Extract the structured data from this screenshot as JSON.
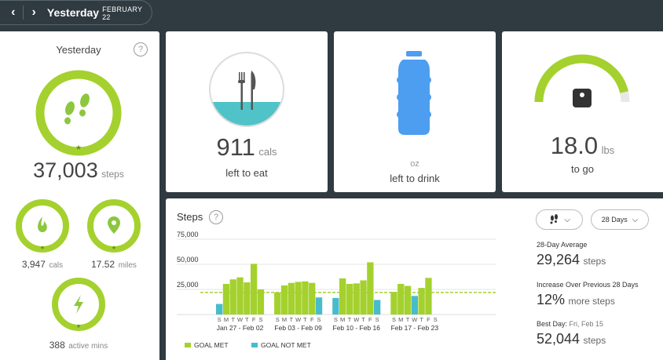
{
  "header": {
    "title": "Yesterday",
    "date": "FEBRUARY 22",
    "prev_icon": "chevron-left-icon",
    "next_icon": "chevron-right-icon"
  },
  "summary": {
    "title": "Yesterday",
    "help": "?",
    "steps_value": "37,003",
    "steps_unit": "steps",
    "cals_value": "3,947",
    "cals_unit": "cals",
    "miles_value": "17.52",
    "miles_unit": "miles",
    "active_value": "388",
    "active_unit": "active mins",
    "colors": {
      "ring": "#a4d12e",
      "icon": "#8dc63f"
    }
  },
  "food": {
    "value": "911",
    "unit": "cals",
    "label": "left to eat"
  },
  "water": {
    "unit": "oz",
    "label": "left to drink",
    "color": "#4d9ef0"
  },
  "weight": {
    "value": "18.0",
    "unit": "lbs",
    "label": "to go"
  },
  "steps_panel": {
    "title": "Steps",
    "help": "?",
    "metric_dropdown_icon": "footsteps-icon",
    "range_dropdown": "28 Days",
    "stats": [
      {
        "title": "28-Day Average",
        "value": "29,264",
        "unit": "steps"
      },
      {
        "title": "Increase Over Previous 28 Days",
        "value": "12%",
        "unit": "more steps"
      },
      {
        "title_prefix": "Best Day:",
        "title_suffix": "Fri, Feb 15",
        "value": "52,044",
        "unit": "steps"
      }
    ],
    "legend": {
      "met": "GOAL MET",
      "not_met": "GOAL NOT MET"
    }
  },
  "chart_data": {
    "type": "bar",
    "ylim": [
      0,
      75000
    ],
    "yticks": [
      "75,000",
      "50,000",
      "25,000"
    ],
    "ytick_values": [
      75000,
      50000,
      25000
    ],
    "goal": 22000,
    "day_labels": [
      "S",
      "M",
      "T",
      "W",
      "T",
      "F",
      "S",
      "S",
      "M",
      "T",
      "W",
      "T",
      "F",
      "S",
      "S",
      "M",
      "T",
      "W",
      "T",
      "F",
      "S",
      "S",
      "M",
      "T",
      "W",
      "T",
      "F",
      "S"
    ],
    "week_labels": [
      "Jan 27 - Feb 02",
      "Feb 03 - Feb 09",
      "Feb 10 - Feb 16",
      "Feb 17 - Feb 23"
    ],
    "values": [
      10500,
      30500,
      35000,
      37000,
      32000,
      50500,
      25000,
      22000,
      29000,
      31500,
      32500,
      33000,
      31500,
      17000,
      16500,
      36000,
      30500,
      31000,
      34000,
      52000,
      14500,
      22500,
      30500,
      28500,
      18500,
      26500,
      36500,
      0
    ],
    "colors": {
      "met": "#a4d12e",
      "not_met": "#48bccb",
      "goal_line": "#a4d12e"
    }
  }
}
